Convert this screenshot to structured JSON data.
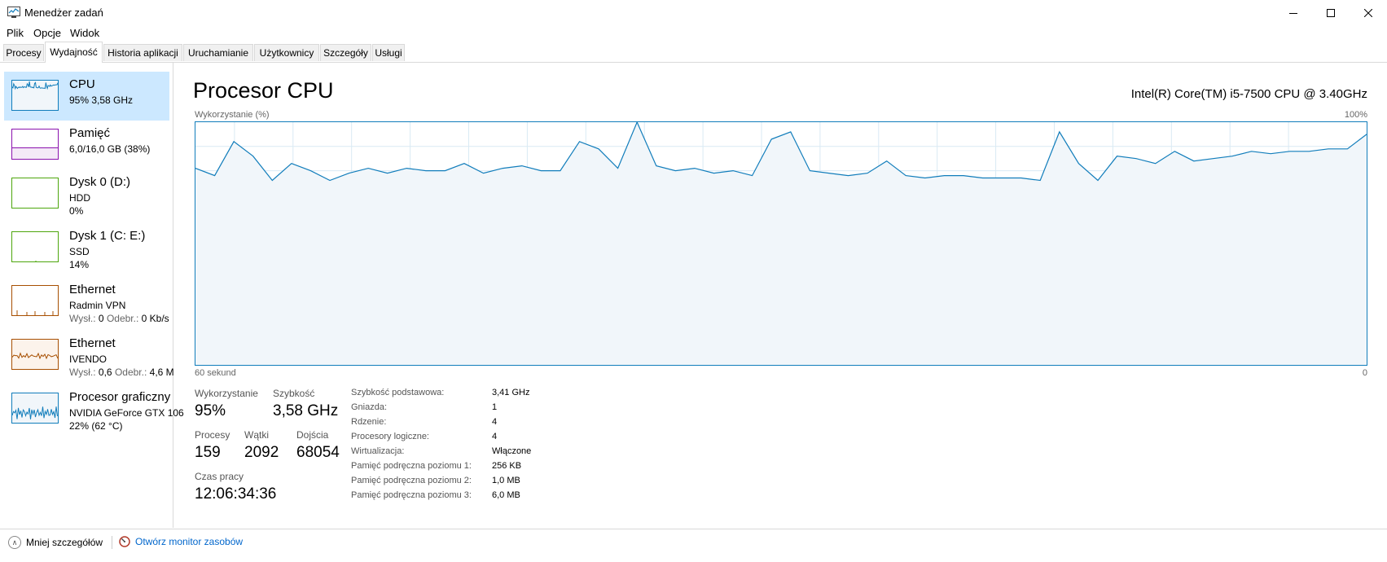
{
  "window": {
    "title": "Menedżer zadań"
  },
  "menu": [
    "Plik",
    "Opcje",
    "Widok"
  ],
  "tabs": [
    "Procesy",
    "Wydajność",
    "Historia aplikacji",
    "Uruchamianie",
    "Użytkownicy",
    "Szczegóły",
    "Usługi"
  ],
  "sidebar": [
    {
      "title": "CPU",
      "line2": "95% 3,58 GHz",
      "line3": "",
      "color": "#117dbb",
      "icon": "cpu-thumbnail",
      "selected": true
    },
    {
      "title": "Pamięć",
      "line2": "6,0/16,0 GB (38%)",
      "line3": "",
      "color": "#8b12ae",
      "icon": "memory-thumbnail",
      "fill_fraction": 0.38
    },
    {
      "title": "Dysk 0 (D:)",
      "line2": "HDD",
      "line3": "0%",
      "color": "#4da60c",
      "icon": "disk-thumbnail"
    },
    {
      "title": "Dysk 1 (C: E:)",
      "line2": "SSD",
      "line3": "14%",
      "color": "#4da60c",
      "icon": "disk-thumbnail"
    },
    {
      "title": "Ethernet",
      "line2": "Radmin VPN",
      "line3_label1": "Wysł.:",
      "line3_val1": "0",
      "line3_label2": "Odebr.:",
      "line3_val2": "0 Kb/s",
      "color": "#a74f01",
      "icon": "ethernet-thumbnail"
    },
    {
      "title": "Ethernet",
      "line2": "IVENDO",
      "line3_label1": "Wysł.:",
      "line3_val1": "0,6",
      "line3_label2": "Odebr.:",
      "line3_val2": "4,6 M",
      "color": "#a74f01",
      "icon": "ethernet-thumbnail"
    },
    {
      "title": "Procesor graficzny",
      "line2": "NVIDIA GeForce GTX 106",
      "line3": "22% (62 °C)",
      "color": "#117dbb",
      "icon": "gpu-thumbnail"
    }
  ],
  "main": {
    "title": "Procesor CPU",
    "model": "Intel(R) Core(TM) i5-7500 CPU @ 3.40GHz",
    "chart_label": "Wykorzystanie (%)",
    "chart_max_label": "100%",
    "chart_time_label": "60 sekund",
    "chart_min_label": "0"
  },
  "chart_data": {
    "type": "area",
    "ylim": [
      0,
      100
    ],
    "x_span_seconds": 60,
    "grid": true,
    "values": [
      81,
      78,
      92,
      86,
      76,
      83,
      80,
      76,
      79,
      81,
      79,
      81,
      80,
      80,
      83,
      79,
      81,
      82,
      80,
      80,
      92,
      89,
      81,
      100,
      82,
      80,
      81,
      79,
      80,
      78,
      93,
      96,
      80,
      79,
      78,
      79,
      84,
      78,
      77,
      78,
      78,
      77,
      77,
      77,
      76,
      96,
      83,
      76,
      86,
      85,
      83,
      88,
      84,
      85,
      86,
      88,
      87,
      88,
      88,
      89,
      89,
      95
    ]
  },
  "stats": {
    "utilization_label": "Wykorzystanie",
    "utilization": "95%",
    "speed_label": "Szybkość",
    "speed": "3,58 GHz",
    "processes_label": "Procesy",
    "processes": "159",
    "threads_label": "Wątki",
    "threads": "2092",
    "handles_label": "Dojścia",
    "handles": "68054",
    "uptime_label": "Czas pracy",
    "uptime": "12:06:34:36"
  },
  "specs": [
    {
      "k": "Szybkość podstawowa:",
      "v": "3,41 GHz"
    },
    {
      "k": "Gniazda:",
      "v": "1"
    },
    {
      "k": "Rdzenie:",
      "v": "4"
    },
    {
      "k": "Procesory logiczne:",
      "v": "4"
    },
    {
      "k": "Wirtualizacja:",
      "v": "Włączone"
    },
    {
      "k": "Pamięć podręczna poziomu 1:",
      "v": "256 KB"
    },
    {
      "k": "Pamięć podręczna poziomu 2:",
      "v": "1,0 MB"
    },
    {
      "k": "Pamięć podręczna poziomu 3:",
      "v": "6,0 MB"
    }
  ],
  "footer": {
    "fewer": "Mniej szczegółów",
    "monitor": "Otwórz monitor zasobów"
  }
}
